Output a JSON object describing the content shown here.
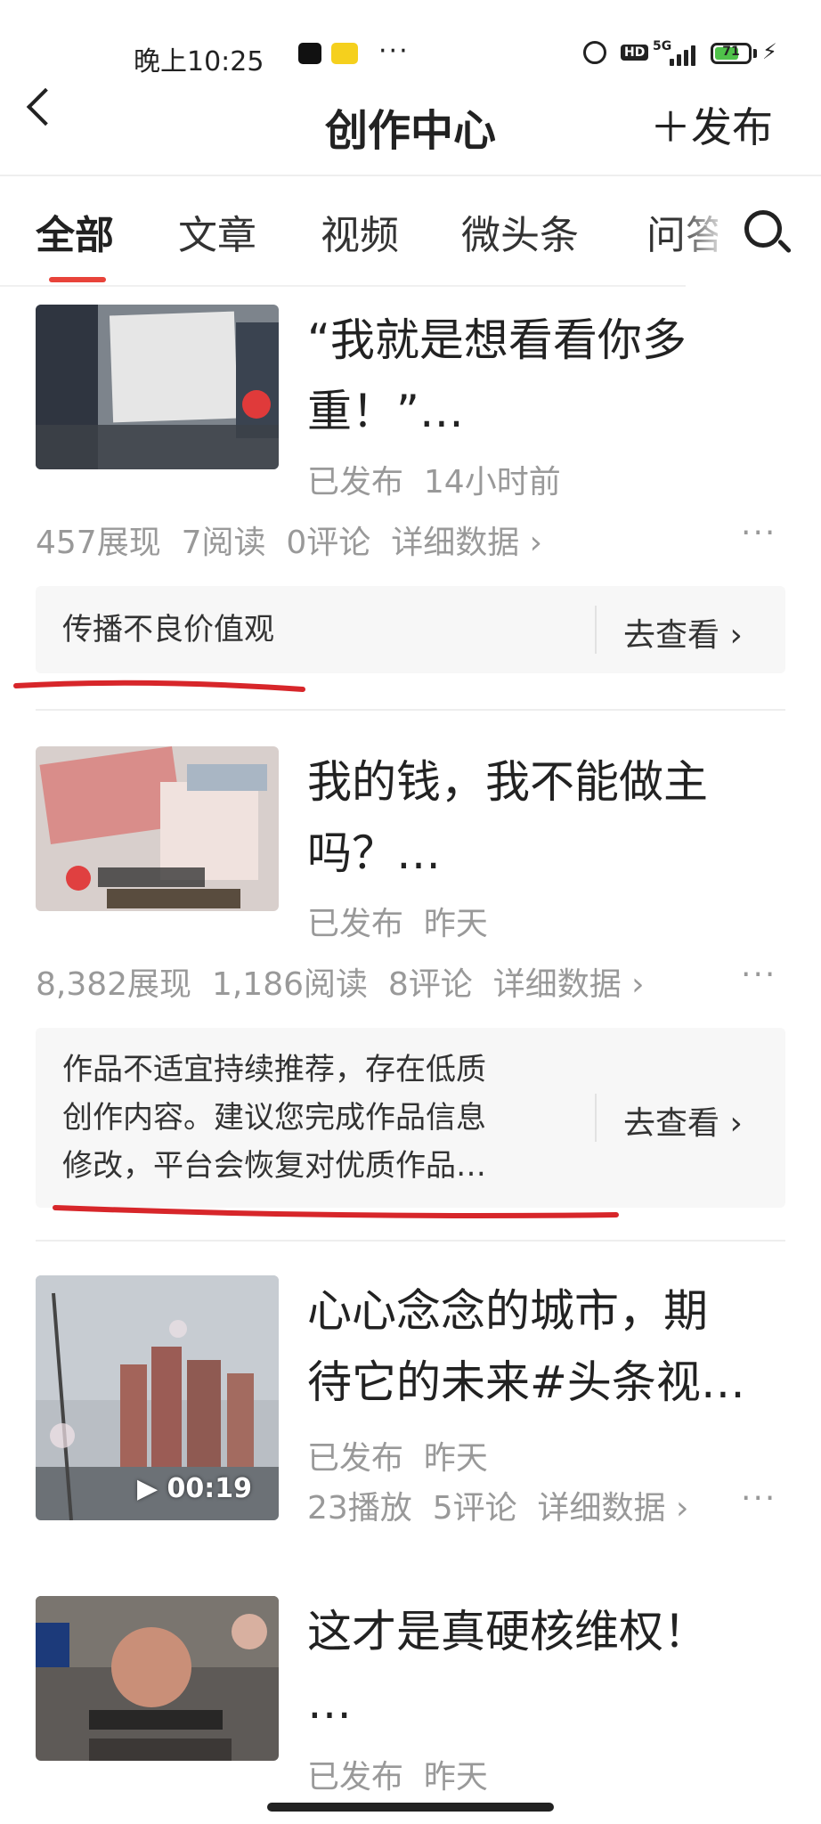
{
  "status_bar": {
    "time": "晚上10:25",
    "dots": "···",
    "hd": "HD",
    "network": "5G",
    "battery": "71",
    "battery_level": 0.71
  },
  "header": {
    "title": "创作中心",
    "publish_label": "＋发布"
  },
  "tabs": [
    {
      "label": "全部",
      "active": true
    },
    {
      "label": "文章",
      "active": false
    },
    {
      "label": "视频",
      "active": false
    },
    {
      "label": "微头条",
      "active": false
    },
    {
      "label": "问答",
      "active": false
    }
  ],
  "articles": [
    {
      "title_line1": "“我就是想看看你多",
      "title_line2": "重！”…",
      "status": "已发布",
      "time": "14小时前",
      "stats": "457展现  7阅读  0评论",
      "detail_link": "详细数据 ›",
      "more": "···",
      "notice": "传播不良价值观",
      "notice_link": "去查看 ›",
      "thumb_color": "#8a8f96"
    },
    {
      "title_line1": "我的钱，我不能做主",
      "title_line2": "吗？…",
      "status": "已发布",
      "time": "昨天",
      "stats": "8,382展现  1,186阅读  8评论",
      "detail_link": "详细数据 ›",
      "more": "···",
      "notice_lines": [
        "作品不适宜持续推荐，存在低质",
        "创作内容。建议您完成作品信息",
        "修改，平台会恢复对优质作品…"
      ],
      "notice_link": "去查看 ›",
      "thumb_color": "#c9a29a"
    },
    {
      "title_line1": "心心念念的城市，期",
      "title_line2": "待它的未来#头条视…",
      "status": "已发布",
      "time": "昨天",
      "stats": "23播放  5评论",
      "detail_link": "详细数据 ›",
      "more": "···",
      "duration": "▶ 00:19",
      "thumb_color": "#9aa3ad"
    },
    {
      "title_line1": "这才是真硬核维权！",
      "title_line2": "…",
      "status": "已发布",
      "time": "昨天",
      "thumb_color": "#6e6a66"
    }
  ],
  "colors": {
    "accent": "#e8433a",
    "annotation_red": "#d7262a"
  }
}
